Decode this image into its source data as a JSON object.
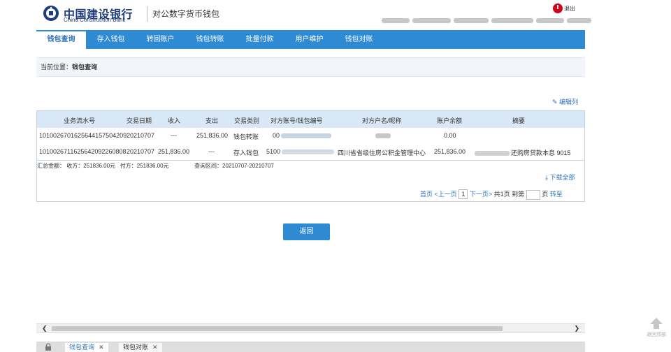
{
  "header": {
    "logo_cn": "中国建设银行",
    "logo_en": "China Construction Bank",
    "subtitle": "对公数字货币钱包",
    "logout_label": "退出"
  },
  "nav": {
    "items": [
      {
        "label": "钱包查询"
      },
      {
        "label": "存入钱包"
      },
      {
        "label": "转回账户"
      },
      {
        "label": "钱包转账"
      },
      {
        "label": "批量付款"
      },
      {
        "label": "用户维护"
      },
      {
        "label": "钱包对账"
      }
    ]
  },
  "breadcrumb": {
    "prefix": "当前位置：",
    "current": "钱包查询"
  },
  "toolbar": {
    "edit_columns": "编辑列"
  },
  "table": {
    "headers": [
      "业务流水号",
      "交易日期",
      "收入",
      "支出",
      "交易类别",
      "对方账号/钱包编号",
      "对方户名/昵称",
      "账户余额",
      "摘要"
    ],
    "rows": [
      {
        "serial": "1010026701625644157504209",
        "date": "20210707",
        "income": "---",
        "expense": "251,836.00",
        "type": "钱包转账",
        "account": "00",
        "name": "",
        "balance": "0.00",
        "memo": ""
      },
      {
        "serial": "1010026711625642092260808",
        "date": "20210707",
        "income": "251,836.00",
        "expense": "---",
        "type": "存入钱包",
        "account": "5100",
        "name": "四川省省级住房公积金管理中心",
        "balance": "251,836.00",
        "memo": "还购房贷款本息  9015"
      }
    ]
  },
  "summary": {
    "label": "汇总金额：",
    "income": "收方：251836.00元",
    "expense": "付方：251836.00元",
    "period": "查询区间：20210707-20210707"
  },
  "download_all": "下载全部",
  "pagination": {
    "first": "首页",
    "prev": "<上一页",
    "current": "1",
    "next": "下一页>",
    "total": "共1页",
    "goto_prefix": "到第",
    "goto_suffix": "页",
    "go": "转至"
  },
  "back_button": "返回",
  "back_to_top": "返回顶部",
  "tabs": [
    {
      "label": "钱包查询",
      "active": true
    },
    {
      "label": "钱包对账",
      "active": false
    }
  ],
  "colors": {
    "primary": "#2d8ad3",
    "brand": "#1e3e7a",
    "link": "#2d72b8",
    "logout": "#d7001b"
  }
}
